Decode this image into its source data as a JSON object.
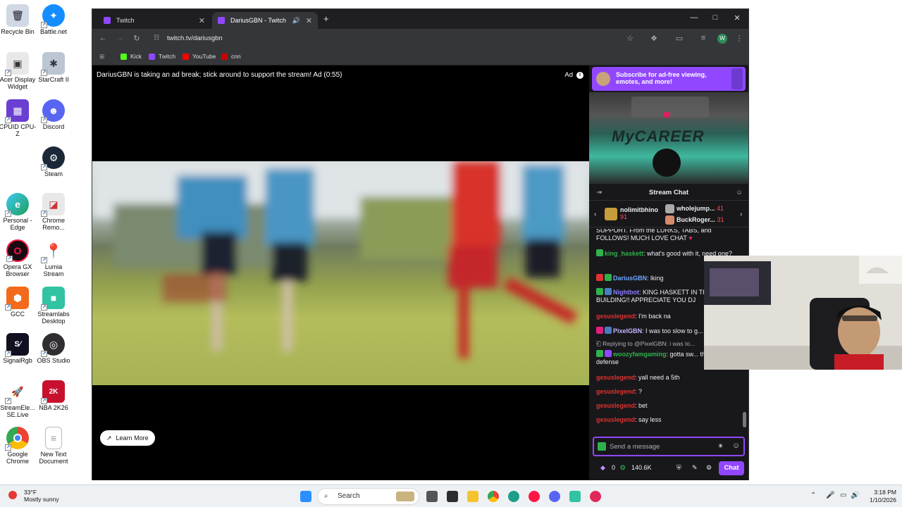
{
  "desktop": {
    "icons": [
      {
        "label": "Recycle Bin"
      },
      {
        "label": "Battle.net"
      },
      {
        "label": "Acer Display Widget"
      },
      {
        "label": "StarCraft II"
      },
      {
        "label": "CPUID CPU-Z"
      },
      {
        "label": "Discord"
      },
      {
        "label": "Steam"
      },
      {
        "label": "Personal - Edge"
      },
      {
        "label": "Chrome Remo..."
      },
      {
        "label": "Opera GX Browser"
      },
      {
        "label": "Lumia Stream"
      },
      {
        "label": "GCC"
      },
      {
        "label": "Streamlabs Desktop"
      },
      {
        "label": "SignalRgb"
      },
      {
        "label": "OBS Studio"
      },
      {
        "label": "StreamEle... SE.Live"
      },
      {
        "label": "NBA 2K26"
      },
      {
        "label": "Google Chrome"
      },
      {
        "label": "New Text Document"
      }
    ]
  },
  "browser": {
    "tabs": [
      {
        "title": "Twitch"
      },
      {
        "title": "DariusGBN - Twitch"
      }
    ],
    "url": "twitch.tv/dariusgbn",
    "profile_initial": "W",
    "bookmarks": [
      {
        "label": "Kick",
        "color": "#53fc18"
      },
      {
        "label": "Twitch",
        "color": "#9147ff"
      },
      {
        "label": "YouTube",
        "color": "#ff0000"
      },
      {
        "label": "cnn",
        "color": "#cc0000"
      }
    ]
  },
  "player": {
    "ad_message": "DariusGBN is taking an ad break; stick around to support the stream! Ad (0:55)",
    "ad_label": "Ad",
    "learn_more": "Learn More"
  },
  "chat": {
    "sub_banner": "Subscribe for ad-free viewing, emotes, and more!",
    "promo_text": "MyCAREER",
    "header": "Stream Chat",
    "leaderboard": [
      {
        "name": "nolimitbhino",
        "bits": "91"
      },
      {
        "name": "wholejump...",
        "bits": "41"
      },
      {
        "name": "BuckRoger...",
        "bits": "31"
      }
    ],
    "messages": [
      {
        "user": "",
        "text": "SUPPORT. From the LURKS, TABS, and FOLLOWS! MUCH LOVE CHAT",
        "user_color": "#efeff1"
      },
      {
        "user": "king_haskett",
        "text": ": what's good with it, need one?",
        "user_color": "#2fb24b"
      },
      {
        "user": "DariusGBN",
        "text": ": lking",
        "user_color": "#6ea8ff"
      },
      {
        "user": "Nightbot",
        "text": ": KING HASKETT IN THE BUILDING!! APPRECIATE YOU DJ",
        "user_color": "#8a7cff"
      },
      {
        "user": "gesuslegend",
        "text": ": I'm back na",
        "user_color": "#e0322f"
      },
      {
        "user": "PixelGBN",
        "text": ": I was too slow to g...",
        "user_color": "#c8b3ff"
      },
      {
        "user": "",
        "text": "Replying to @PixelGBN: i was to...",
        "user_color": "#adadb8"
      },
      {
        "user": "woozyfamgaming",
        "text": ": gotta sw... the locks on defense",
        "user_color": "#2fb24b"
      },
      {
        "user": "gesuslegend",
        "text": ": yall need a 5th",
        "user_color": "#e0322f"
      },
      {
        "user": "gesuslegend",
        "text": ": ?",
        "user_color": "#e0322f"
      },
      {
        "user": "gesuslegend",
        "text": ": bet",
        "user_color": "#e0322f"
      },
      {
        "user": "gesuslegend",
        "text": ": say less",
        "user_color": "#e0322f"
      }
    ],
    "input_placeholder": "Send a message",
    "points_left": "0",
    "points_right": "140.6K",
    "send_label": "Chat"
  },
  "taskbar": {
    "weather_temp": "33°F",
    "weather_desc": "Mostly sunny",
    "search": "Search",
    "time": "3:18 PM",
    "date": "1/10/2026"
  }
}
